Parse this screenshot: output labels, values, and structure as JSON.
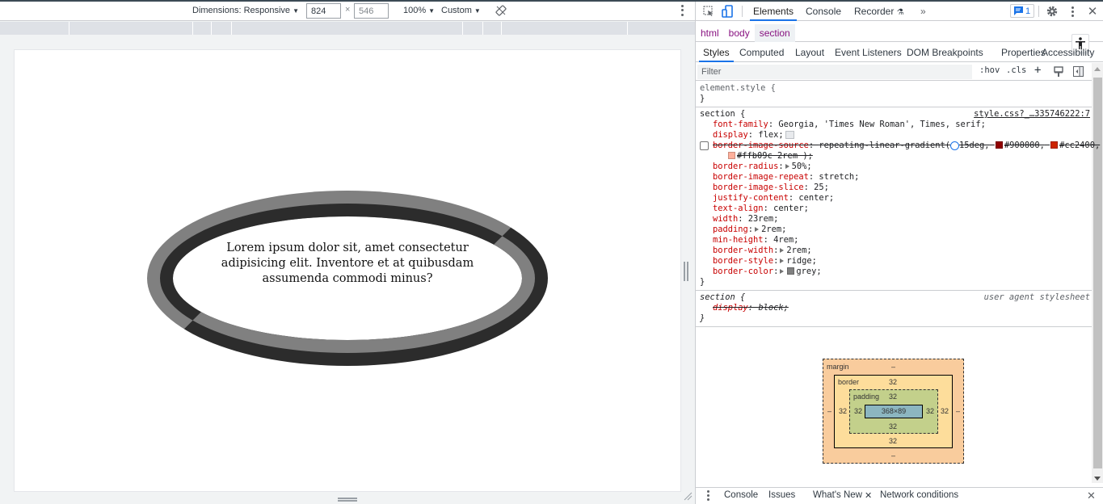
{
  "device_toolbar": {
    "dimensions_label": "Dimensions: Responsive",
    "width_value": "824",
    "height_value": "546",
    "times": "×",
    "zoom_label": "100%",
    "throttle_label": "Custom"
  },
  "page": {
    "section_text": "Lorem ipsum dolor sit, amet consectetur adipisicing elit. Inventore et at quibusdam assumenda commodi minus?",
    "border_color": "#808080",
    "border_dark": "#2b2b2b"
  },
  "devtools": {
    "tabs": [
      {
        "label": "Elements",
        "active": true
      },
      {
        "label": "Console",
        "active": false
      },
      {
        "label": "Recorder",
        "active": false
      }
    ],
    "more_tabs": "»",
    "issues_count": "1",
    "breadcrumbs": [
      "html",
      "body",
      "section"
    ],
    "subtabs": [
      "Styles",
      "Computed",
      "Layout",
      "Event Listeners",
      "DOM Breakpoints",
      "Properties",
      "Accessibility"
    ],
    "filter_placeholder": "Filter",
    "hov": ":hov",
    "cls": ".cls",
    "rules": {
      "element_style": {
        "selector": "element.style {",
        "close": "}"
      },
      "section": {
        "selector": "section {",
        "source": "style.css?_…335746222:7",
        "decls": [
          {
            "name": "font-family",
            "value": "Georgia, 'Times New Roman', Times, serif;"
          },
          {
            "name": "display",
            "value": "flex;"
          },
          {
            "name": "border-image-source",
            "value": "repeating-linear-gradient(",
            "angle": "15deg,",
            "c1": "#900000,",
            "c2": "#cc2400,",
            "c3": "#ffb09c 2rem );"
          },
          {
            "name": "border-radius",
            "value": "50%;"
          },
          {
            "name": "border-image-repeat",
            "value": "stretch;"
          },
          {
            "name": "border-image-slice",
            "value": "25;"
          },
          {
            "name": "justify-content",
            "value": "center;"
          },
          {
            "name": "text-align",
            "value": "center;"
          },
          {
            "name": "width",
            "value": "23rem;"
          },
          {
            "name": "padding",
            "value": "2rem;"
          },
          {
            "name": "min-height",
            "value": "4rem;"
          },
          {
            "name": "border-width",
            "value": "2rem;"
          },
          {
            "name": "border-style",
            "value": "ridge;"
          },
          {
            "name": "border-color",
            "value": "grey;"
          }
        ],
        "close": "}"
      },
      "ua_section": {
        "selector": "section {",
        "source": "user agent stylesheet",
        "decl_name": "display",
        "decl_value": "block;",
        "close": "}"
      }
    },
    "swatches": {
      "c1": "#900000",
      "c2": "#cc2400",
      "c3": "#ffb09c",
      "grey": "#808080"
    },
    "box_model": {
      "margin_label": "margin",
      "margin_top": "–",
      "margin_bottom": "–",
      "margin_left": "–",
      "margin_right": "–",
      "border_label": "border",
      "border_top": "32",
      "border_bottom": "32",
      "border_left": "32",
      "border_right": "32",
      "padding_label": "padding",
      "padding_top": "32",
      "padding_bottom": "32",
      "padding_left": "32",
      "padding_right": "32",
      "content": "368×89"
    },
    "drawer_tabs": [
      "Console",
      "Issues",
      "What's New",
      "Network conditions"
    ]
  }
}
